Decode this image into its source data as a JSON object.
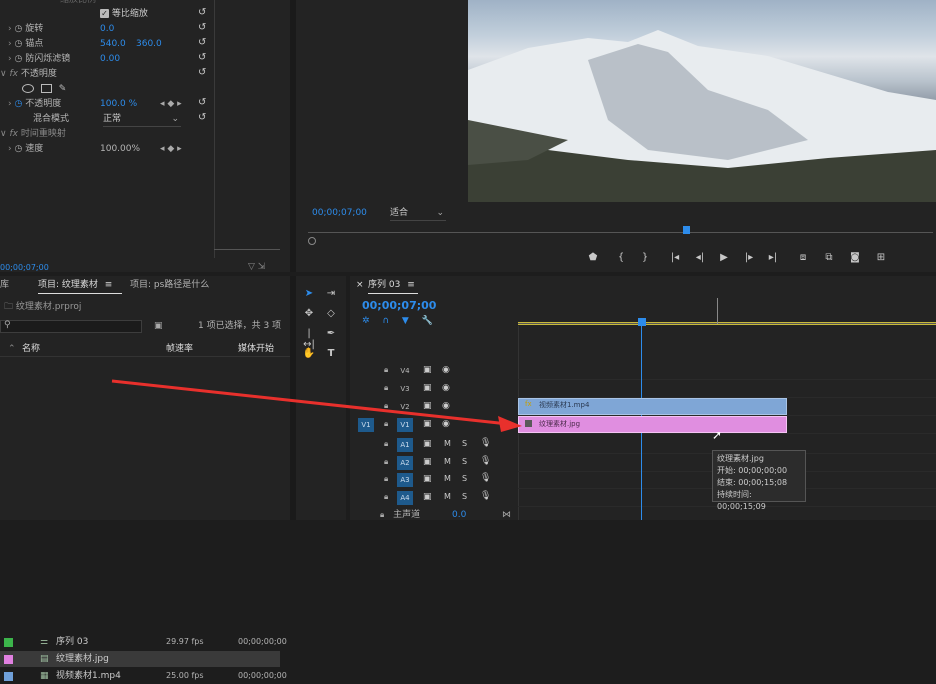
{
  "effect_controls": {
    "truncated_top_label": "缩放比例",
    "uniform_scale": "等比缩放",
    "rotation": {
      "label": "旋转",
      "value": "0.0"
    },
    "anchor": {
      "label": "锚点",
      "x": "540.0",
      "y": "360.0"
    },
    "antiflicker": {
      "label": "防闪烁滤镜",
      "value": "0.00"
    },
    "opacity_group": {
      "fx": "fx",
      "label": "不透明度"
    },
    "opacity": {
      "label": "不透明度",
      "value": "100.0 %"
    },
    "blend_mode": {
      "label": "混合模式",
      "value": "正常"
    },
    "time_remap": {
      "fx": "fx",
      "label": "时间重映射"
    },
    "speed": {
      "label": "速度",
      "value": "100.00%"
    },
    "timecode": "00;00;07;00"
  },
  "program_monitor": {
    "timecode": "00;00;07;00",
    "fit": "适合"
  },
  "project_panel": {
    "tab_lib": "库",
    "tab_project": "项目: 纹理素材",
    "tab_project2": "项目: ps路径是什么",
    "project_file": "纹理素材.prproj",
    "selection_info": "1 项已选择，共 3 项",
    "columns": {
      "name": "名称",
      "fps": "帧速率",
      "media_start": "媒体开始"
    },
    "items": [
      {
        "name": "序列 03",
        "fps": "29.97 fps",
        "start": "00;00;00;00",
        "color": "#3cb44b"
      },
      {
        "name": "纹理素材.jpg",
        "fps": "",
        "start": "",
        "color": "#e080e0"
      },
      {
        "name": "视频素材1.mp4",
        "fps": "25.00 fps",
        "start": "00;00;00;00",
        "color": "#6f9fd8"
      }
    ]
  },
  "timeline": {
    "sequence_tab": "序列 03",
    "timecode": "00;00;07;00",
    "tracks_video": [
      "V4",
      "V3",
      "V2",
      "V1"
    ],
    "tracks_audio": [
      "A1",
      "A2",
      "A3",
      "A4"
    ],
    "source_patch_v": "V1",
    "master": {
      "label": "主声道",
      "value": "0.0"
    },
    "clip_video": "视频素材1.mp4",
    "clip_image": "纹理素材.jpg",
    "tooltip": {
      "name": "纹理素材.jpg",
      "start": "开始: 00;00;00;00",
      "end": "结束: 00;00;15;08",
      "duration": "持续时间: 00;00;15;09"
    }
  },
  "colors": {
    "accent": "#2d8ceb",
    "arrow": "#e8302c",
    "pink_clip": "#e08ee0",
    "blue_clip": "#7fa6d6"
  }
}
